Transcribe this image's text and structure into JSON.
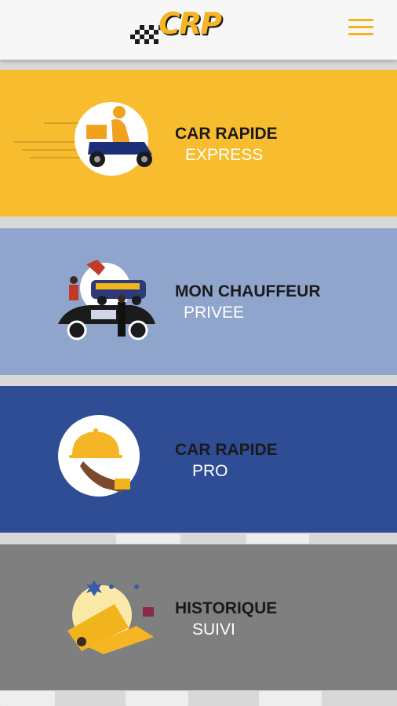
{
  "header": {
    "logo_text": "CRP",
    "menu_icon": "hamburger-menu-icon"
  },
  "colors": {
    "header_bg": "#f7f7f7",
    "accent": "#f2b41c",
    "express_bg": "#f8bd2f",
    "chauffeur_bg": "#8fa5cc",
    "pro_bg": "#2f4d95",
    "historique_bg": "#7f7f7f"
  },
  "menu": [
    {
      "title": "CAR RAPIDE",
      "subtitle": "EXPRESS",
      "icon": "scooter-delivery-icon"
    },
    {
      "title": "MON CHAUFFEUR",
      "subtitle": "PRIVEE",
      "icon": "private-driver-icon"
    },
    {
      "title": "CAR RAPIDE",
      "subtitle": "PRO",
      "icon": "serving-cloche-icon"
    },
    {
      "title": "HISTORIQUE",
      "subtitle": "SUIVI",
      "icon": "history-tickets-icon"
    }
  ]
}
